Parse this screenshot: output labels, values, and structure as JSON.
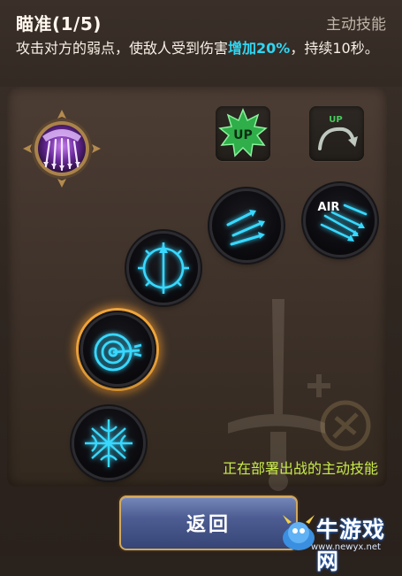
{
  "header": {
    "title": "瞄准(1/5)",
    "skill_type": "主动技能",
    "description_prefix": "攻击对方的弱点，使敌人受到伤害",
    "description_highlight": "增加20%",
    "description_suffix": "，持续10秒。"
  },
  "panel": {
    "deploy_status": "正在部署出战的主动技能",
    "upgrade_badge_text": "UP",
    "upgrade_arrow_text": "UP",
    "air_node_text": "AIR"
  },
  "footer": {
    "back_label": "返回",
    "watermark_name": "牛游戏网",
    "watermark_url": "www.newyx.net"
  },
  "colors": {
    "highlight": "#2fd6f2",
    "deploy_text": "#c8ea4a",
    "node_glow": "#38d8ff",
    "selected_ring": "#f0a53a",
    "upgrade_green": "#2fae4a"
  },
  "icons": {
    "skill_portrait": "purple-arrow-volley-icon",
    "upgrade_badge": "green-up-star-icon",
    "upgrade_arrow": "curved-up-arrow-icon",
    "node_multi_arrow": "triple-arrow-icon",
    "node_air": "air-arrows-icon",
    "node_compass": "compass-arrow-icon",
    "node_target": "target-bullseye-icon",
    "node_snowflake": "arrow-star-icon"
  }
}
